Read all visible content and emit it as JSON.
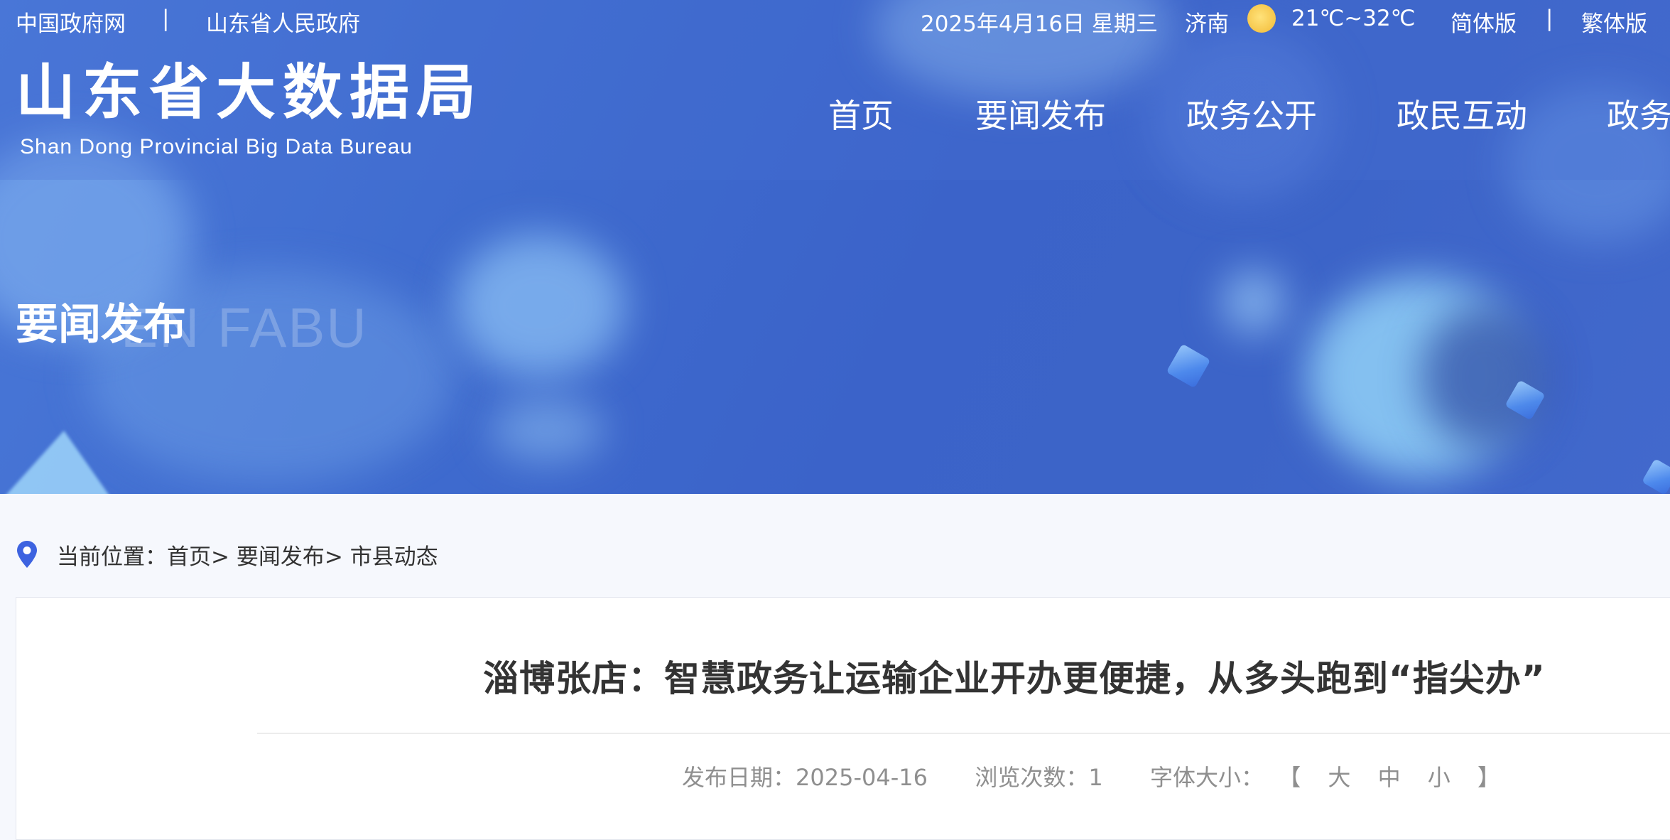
{
  "topbar": {
    "link_gov": "中国政府网",
    "separator": "|",
    "link_province": "山东省人民政府",
    "date": "2025年4月16日 星期三",
    "city": "济南",
    "weather_icon": "sun-icon",
    "temperature": "21℃~32℃",
    "simplified": "简体版",
    "traditional": "繁体版"
  },
  "logo": {
    "name_cn": "山东省大数据局",
    "name_en": "Shan Dong Provincial Big Data Bureau"
  },
  "nav": {
    "items": [
      "首页",
      "要闻发布",
      "政务公开",
      "政民互动",
      "政务"
    ]
  },
  "section": {
    "title": "要闻发布",
    "watermark": "EN FABU"
  },
  "breadcrumb": {
    "icon": "location-pin-icon",
    "prefix": "当前位置：",
    "items": [
      "首页",
      "要闻发布",
      "市县动态"
    ],
    "sep": ">"
  },
  "article": {
    "title": "淄博张店：智慧政务让运输企业开办更便捷，从多头跑到“指尖办”",
    "date_label": "发布日期：",
    "date": "2025-04-16",
    "views_label": "浏览次数：",
    "views": "1",
    "font_size_label": "字体大小：",
    "bracket_open": "【",
    "size_large": "大",
    "size_medium": "中",
    "size_small": "小",
    "bracket_close": "】"
  },
  "colors": {
    "banner": "#3f6ccf",
    "accent_pin": "#3d63e0"
  }
}
